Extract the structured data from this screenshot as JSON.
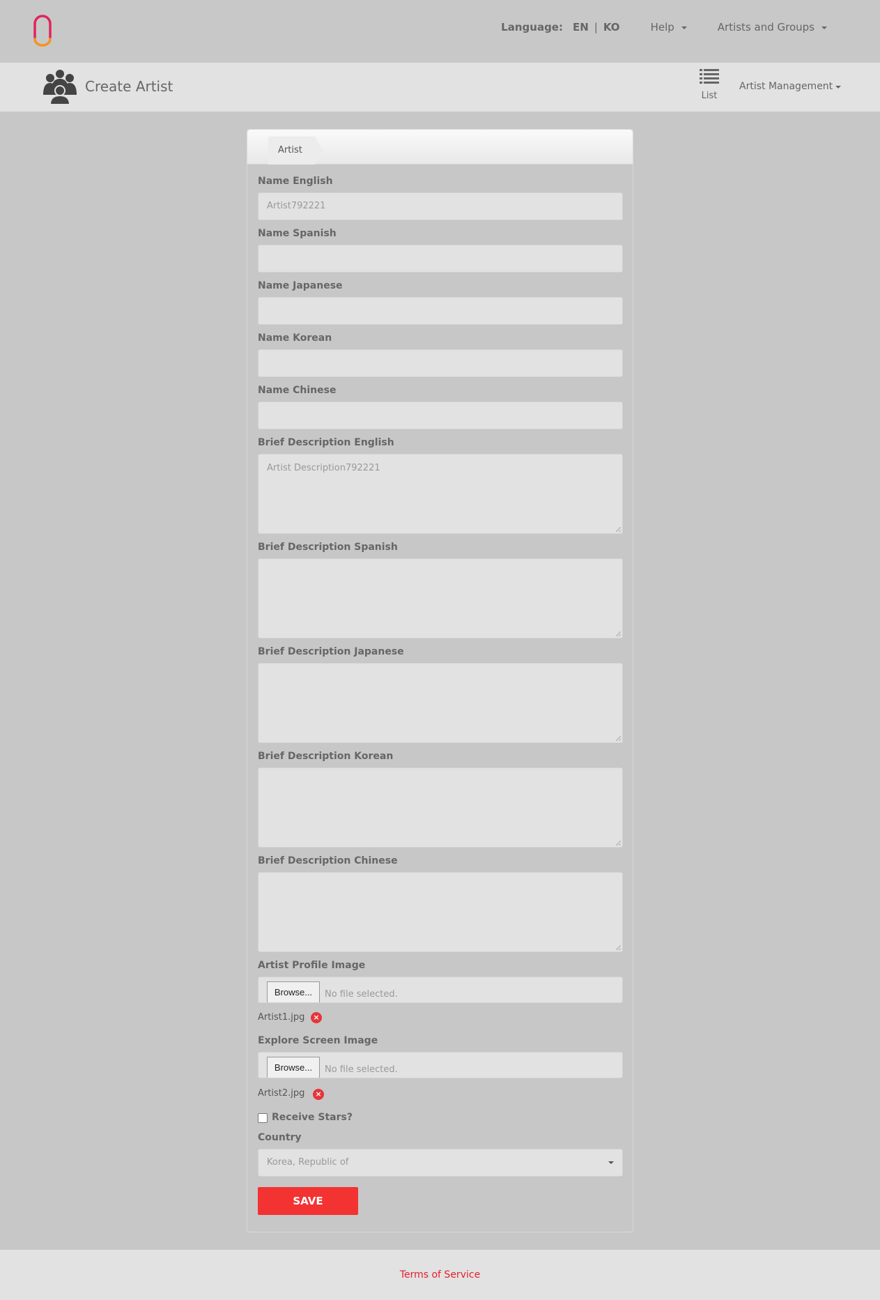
{
  "header": {
    "language_label": "Language:",
    "lang_en": "EN",
    "lang_sep": "|",
    "lang_ko": "KO",
    "help_label": "Help",
    "artists_groups_label": "Artists and Groups"
  },
  "subheader": {
    "title": "Create Artist",
    "list_label": "List",
    "management_label": "Artist Management"
  },
  "tab": {
    "label": "Artist"
  },
  "fields": {
    "name_english": {
      "label": "Name English",
      "value": "Artist792221"
    },
    "name_spanish": {
      "label": "Name Spanish",
      "value": ""
    },
    "name_japanese": {
      "label": "Name Japanese",
      "value": ""
    },
    "name_korean": {
      "label": "Name Korean",
      "value": ""
    },
    "name_chinese": {
      "label": "Name Chinese",
      "value": ""
    },
    "desc_english": {
      "label": "Brief Description English",
      "value": "Artist Description792221"
    },
    "desc_spanish": {
      "label": "Brief Description Spanish",
      "value": ""
    },
    "desc_japanese": {
      "label": "Brief Description Japanese",
      "value": ""
    },
    "desc_korean": {
      "label": "Brief Description Korean",
      "value": ""
    },
    "desc_chinese": {
      "label": "Brief Description Chinese",
      "value": ""
    },
    "profile_image": {
      "label": "Artist Profile Image",
      "browse": "Browse...",
      "status": "No file selected.",
      "file": "Artist1.jpg"
    },
    "explore_image": {
      "label": "Explore Screen Image",
      "browse": "Browse...",
      "status": "No file selected.",
      "file": "Artist2.jpg"
    },
    "receive_stars": {
      "label": "Receive Stars?",
      "checked": false
    },
    "country": {
      "label": "Country",
      "value": "Korea, Republic of"
    }
  },
  "actions": {
    "save": "SAVE"
  },
  "footer": {
    "terms": "Terms of Service"
  },
  "colors": {
    "accent": "#f33232",
    "link": "#e61e2a"
  }
}
